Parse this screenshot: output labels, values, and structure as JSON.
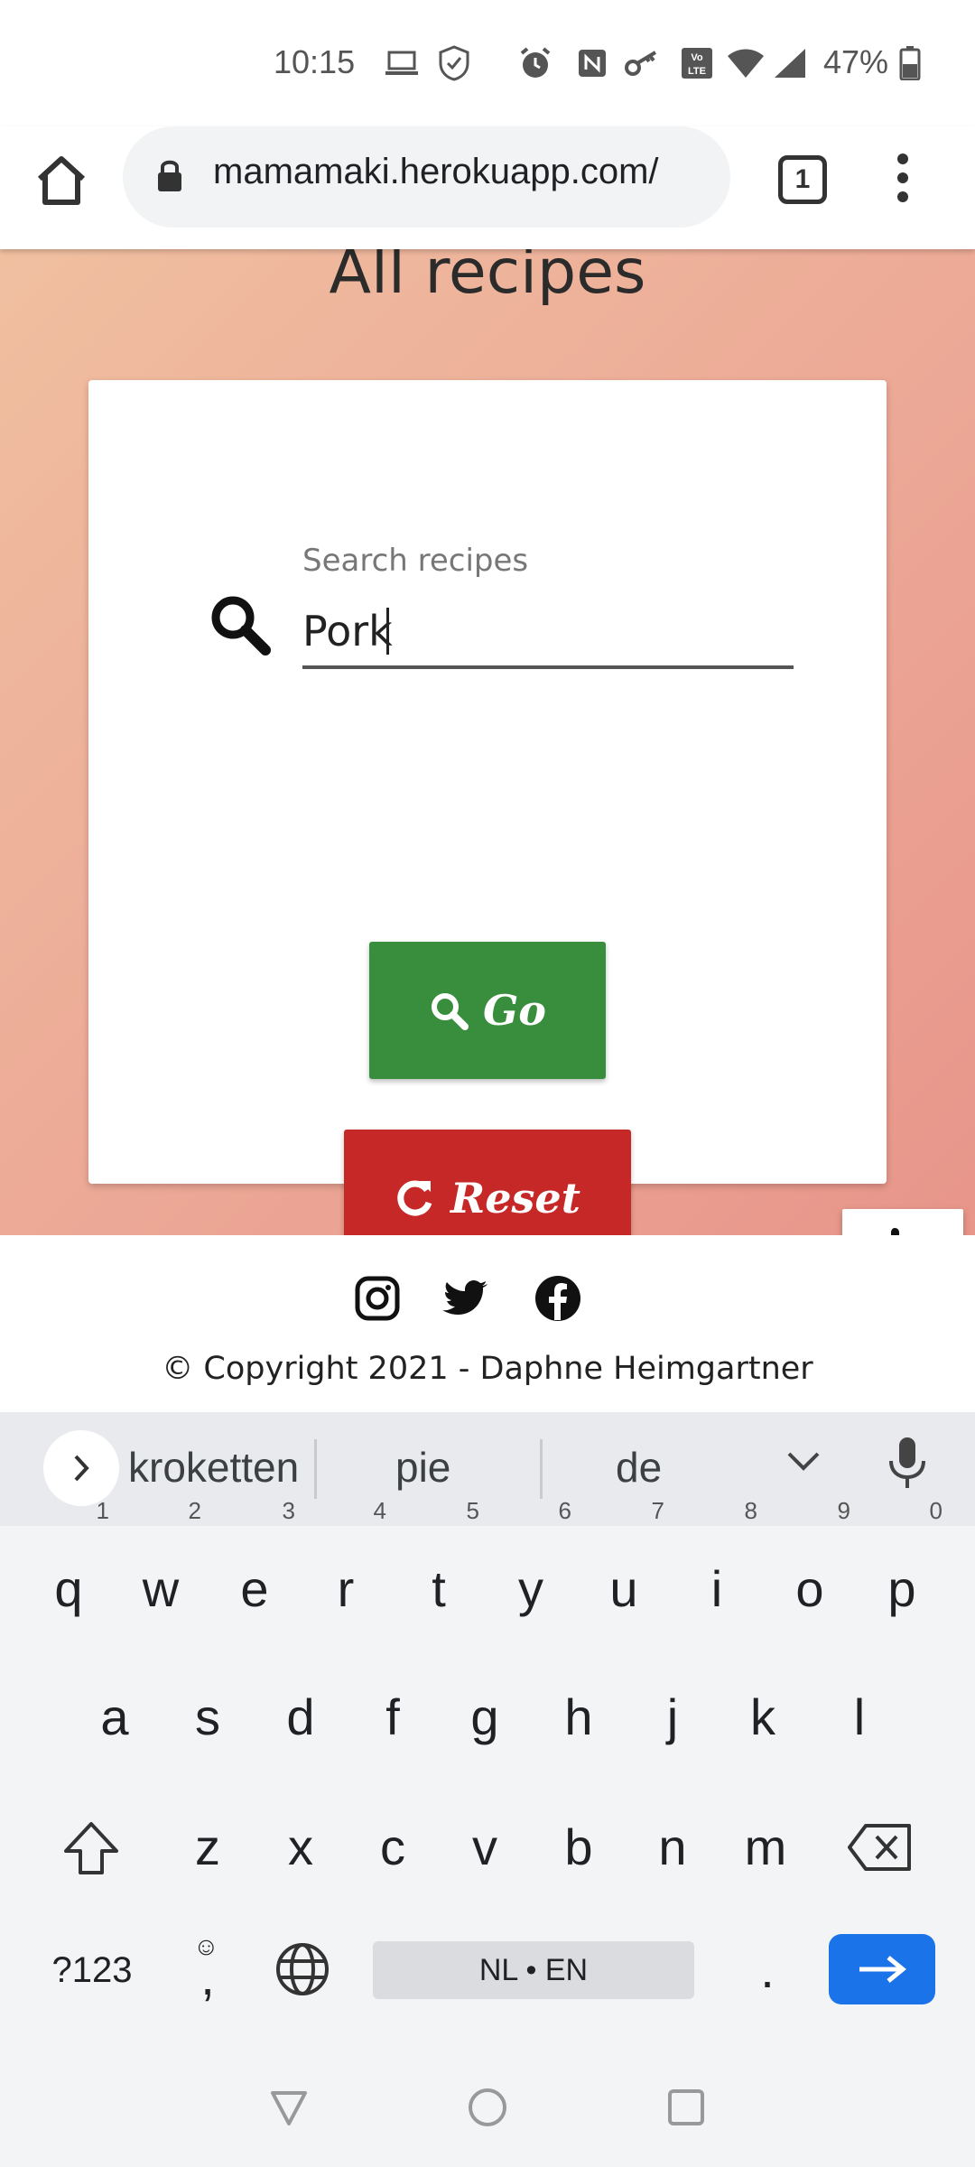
{
  "status_bar": {
    "time": "10:15",
    "battery": "47%",
    "icons": [
      "laptop-icon",
      "shield-icon",
      "alarm-icon",
      "nfc-icon",
      "key-icon",
      "volte-icon",
      "wifi-icon",
      "signal-icon",
      "battery-icon"
    ],
    "volte_label": "Vo LTE"
  },
  "browser": {
    "url": "mamamaki.herokuapp.com/",
    "tab_count": "1"
  },
  "page": {
    "title": "All recipes",
    "search": {
      "label": "Search recipes",
      "value": "Pork"
    },
    "go_label": "Go",
    "reset_label": "Reset",
    "colors": {
      "go": "#388e3c",
      "reset": "#c62828"
    }
  },
  "footer": {
    "social": [
      "instagram-icon",
      "twitter-icon",
      "facebook-icon"
    ],
    "copyright": "© Copyright 2021 - Daphne Heimgartner"
  },
  "keyboard": {
    "suggestions": [
      "kroketten",
      "pie",
      "de"
    ],
    "row1": [
      "q",
      "w",
      "e",
      "r",
      "t",
      "y",
      "u",
      "i",
      "o",
      "p"
    ],
    "row1_hints": [
      "1",
      "2",
      "3",
      "4",
      "5",
      "6",
      "7",
      "8",
      "9",
      "0"
    ],
    "row2": [
      "a",
      "s",
      "d",
      "f",
      "g",
      "h",
      "j",
      "k",
      "l"
    ],
    "row3": [
      "z",
      "x",
      "c",
      "v",
      "b",
      "n",
      "m"
    ],
    "symbols_label": "?123",
    "comma_label": ",",
    "space_label": "NL • EN",
    "period_label": "."
  }
}
